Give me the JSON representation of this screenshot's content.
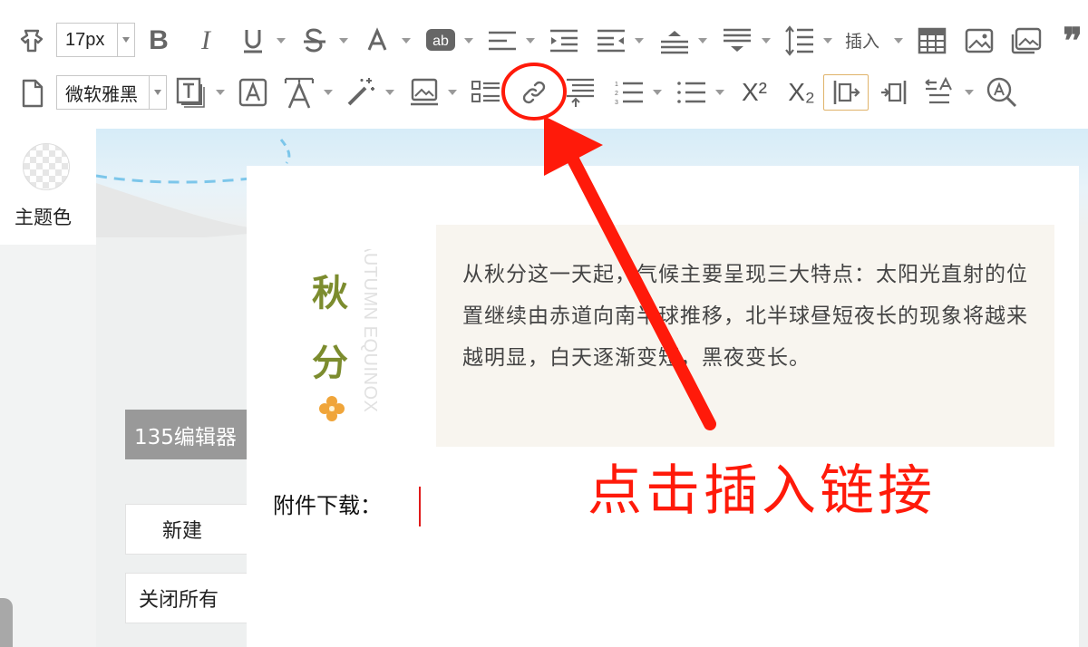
{
  "toolbar": {
    "font_size_value": "17px",
    "font_family_value": "微软雅黑",
    "insert_label": "插入",
    "superscript_label": "X²",
    "subscript_label": "X₂"
  },
  "sidebar": {
    "theme_color_label": "主题色",
    "buttons": {
      "editor_label": "135编辑器",
      "new_label": "新建",
      "close_all_label": "关闭所有"
    }
  },
  "document": {
    "title_chars": [
      "秋",
      "分"
    ],
    "english_title": "AUTUMN EQUINOX",
    "quote_text": "从秋分这一天起，气候主要呈现三大特点：太阳光直射的位置继续由赤道向南半球推移，北半球昼短夜长的现象将越来越明显，白天逐渐变短，黑夜变长。",
    "attachment_label": "附件下载："
  },
  "annotation": {
    "text": "点击插入链接",
    "color": "#ff1a0a"
  },
  "colors": {
    "title_green": "#7c8c2e",
    "flower_orange": "#f0a53a",
    "quote_bg": "#f8f5ef",
    "highlight_border": "#e0b36a"
  }
}
